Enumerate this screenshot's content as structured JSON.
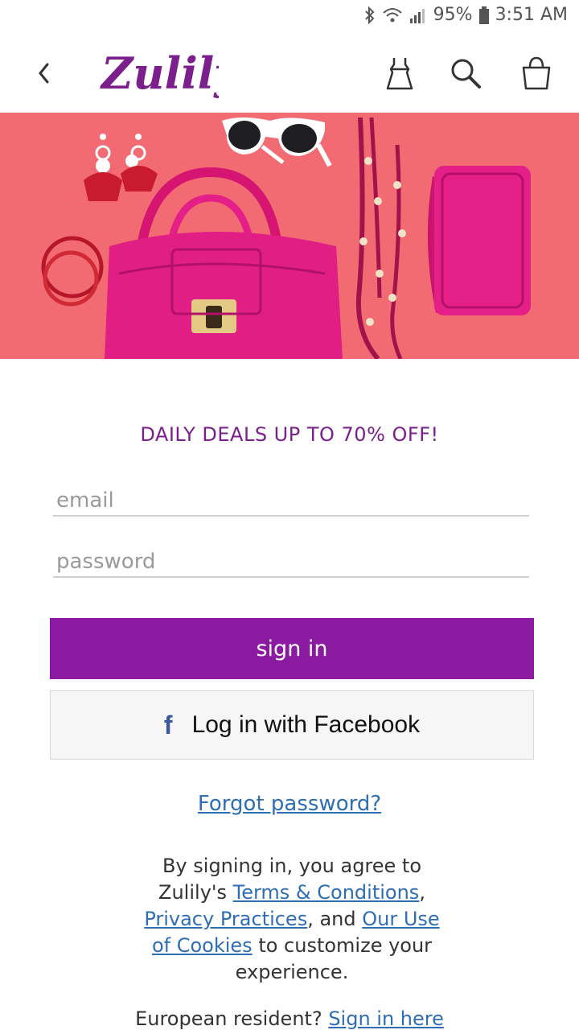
{
  "status_bar": {
    "battery": "95%",
    "time": "3:51 AM",
    "icons": [
      "bluetooth-icon",
      "wifi-icon",
      "signal-icon",
      "battery-icon"
    ]
  },
  "header": {
    "logo_text": "Zulily",
    "icons": [
      "back-icon",
      "dress-icon",
      "search-icon",
      "cart-icon"
    ]
  },
  "hero": {
    "icons": [
      "sunglasses",
      "earrings",
      "handbag",
      "necklace",
      "wallet"
    ]
  },
  "login": {
    "tagline": "DAILY DEALS UP TO 70% OFF!",
    "email_placeholder": "email",
    "password_placeholder": "password",
    "signin_label": "sign in",
    "facebook_label": "Log in with Facebook",
    "facebook_glyph": "f",
    "forgot_label": "Forgot password?"
  },
  "legal": {
    "prefix": "By signing in, you agree to Zulily's ",
    "terms_link": "Terms & Conditions",
    "comma": ", ",
    "privacy_link": "Privacy Practices",
    "and": ", and ",
    "cookies_link": "Our Use of Cookies",
    "suffix": " to customize your experience."
  },
  "european": {
    "prefix": "European resident? ",
    "link": "Sign in here"
  },
  "colors": {
    "brand_purple": "#8a1a9f",
    "tagline_purple": "#7a1f8c",
    "hero_background": "#f36b72",
    "link_blue": "#2f6db5",
    "facebook_blue": "#3b5998"
  }
}
